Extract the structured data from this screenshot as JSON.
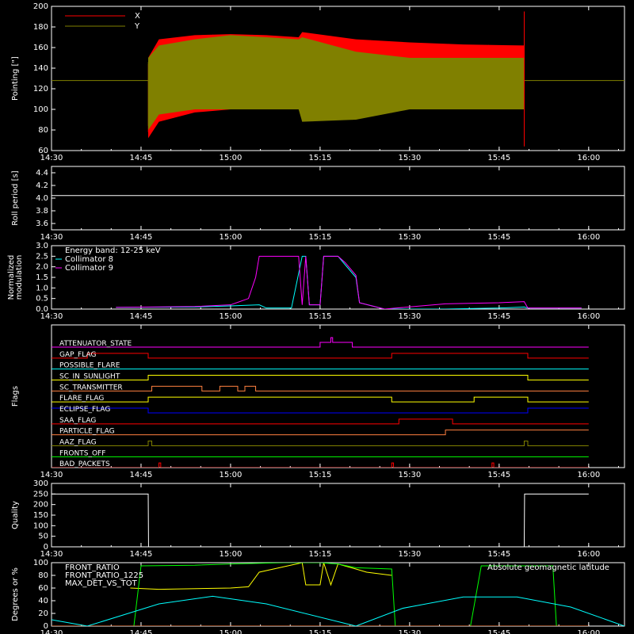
{
  "chart_data": [
    {
      "type": "line",
      "ylabel": "Pointing [\"]",
      "ylim": [
        60,
        200
      ],
      "yticks": [
        60,
        80,
        100,
        120,
        140,
        160,
        180,
        200
      ],
      "xticks": [
        "14:30",
        "14:45",
        "15:00",
        "15:15",
        "15:30",
        "15:45",
        "16:00"
      ],
      "series": [
        {
          "name": "X",
          "color": "#ff0000",
          "t": [
            14.77,
            14.8,
            14.9,
            15.0,
            15.1,
            15.19,
            15.2,
            15.35,
            15.5,
            15.65,
            15.82
          ],
          "upper": [
            150,
            168,
            172,
            173,
            172,
            170,
            175,
            168,
            165,
            163,
            162
          ],
          "lower": [
            72,
            88,
            97,
            100,
            103,
            102,
            100,
            107,
            104,
            108,
            110
          ]
        },
        {
          "name": "Y",
          "color": "#808000",
          "t": [
            14.77,
            14.8,
            14.9,
            15.0,
            15.1,
            15.19,
            15.2,
            15.35,
            15.5,
            15.65,
            15.82
          ],
          "upper": [
            150,
            162,
            168,
            172,
            170,
            168,
            170,
            156,
            150,
            150,
            150
          ],
          "lower": [
            80,
            95,
            100,
            100,
            100,
            100,
            88,
            90,
            100,
            100,
            100
          ]
        }
      ],
      "baseline": 128
    },
    {
      "type": "line",
      "ylabel": "Roll period [s]",
      "ylim": [
        3.5,
        4.5
      ],
      "yticks": [
        3.6,
        3.8,
        4.0,
        4.2,
        4.4
      ],
      "xticks": [
        "14:30",
        "14:45",
        "15:00",
        "15:15",
        "15:30",
        "15:45",
        "16:00"
      ],
      "series": [
        {
          "name": "roll",
          "color": "#ffffff",
          "value": 4.04
        }
      ]
    },
    {
      "type": "line",
      "ylabel": "Normalized modulation",
      "ylim": [
        0,
        3.0
      ],
      "yticks": [
        0.0,
        0.5,
        1.0,
        1.5,
        2.0,
        2.5,
        3.0
      ],
      "xticks": [
        "14:30",
        "14:45",
        "15:00",
        "15:15",
        "15:30",
        "15:45",
        "16:00"
      ],
      "legend": [
        "Energy band: 12-25 keV",
        "Collimator 8",
        "Collimator 9"
      ],
      "series": [
        {
          "name": "Collimator 8",
          "color": "#00ffff",
          "t": [
            14.68,
            14.9,
            15.0,
            15.08,
            15.1,
            15.17,
            15.2,
            15.21,
            15.22,
            15.25,
            15.26,
            15.3,
            15.32,
            15.35,
            15.36,
            15.43,
            15.6,
            15.75,
            15.82,
            15.83,
            15.98
          ],
          "v": [
            0.08,
            0.1,
            0.15,
            0.2,
            0.05,
            0.05,
            2.5,
            2.5,
            0.2,
            0.2,
            2.5,
            2.5,
            2.1,
            1.5,
            0.3,
            0.0,
            0.0,
            0.05,
            0.1,
            0.05,
            0.05
          ]
        },
        {
          "name": "Collimator 9",
          "color": "#ff00ff",
          "t": [
            14.68,
            14.9,
            15.0,
            15.05,
            15.07,
            15.08,
            15.1,
            15.19,
            15.2,
            15.21,
            15.22,
            15.25,
            15.26,
            15.3,
            15.32,
            15.35,
            15.36,
            15.43,
            15.6,
            15.75,
            15.82,
            15.83,
            15.98
          ],
          "v": [
            0.08,
            0.12,
            0.2,
            0.5,
            1.5,
            2.5,
            2.5,
            2.5,
            0.2,
            2.5,
            0.2,
            0.2,
            2.5,
            2.5,
            2.2,
            1.6,
            0.3,
            0.0,
            0.25,
            0.3,
            0.35,
            0.05,
            0.05
          ]
        }
      ]
    },
    {
      "type": "table",
      "ylabel": "Flags",
      "xticks": [
        "14:30",
        "14:45",
        "15:00",
        "15:15",
        "15:30",
        "15:45",
        "16:00"
      ],
      "flags": [
        {
          "name": "ATTENUATOR_STATE",
          "color": "#ff00ff",
          "segments": [
            [
              14.5,
              0
            ],
            [
              15.25,
              1
            ],
            [
              15.28,
              2
            ],
            [
              15.285,
              1
            ],
            [
              15.34,
              0
            ],
            [
              16.0,
              0
            ]
          ]
        },
        {
          "name": "GAP_FLAG",
          "color": "#ff0000",
          "segments": [
            [
              14.5,
              0
            ],
            [
              14.6,
              1
            ],
            [
              14.77,
              0
            ],
            [
              15.45,
              1
            ],
            [
              15.83,
              0
            ],
            [
              16.0,
              0
            ]
          ]
        },
        {
          "name": "POSSIBLE_FLARE",
          "color": "#00ffff",
          "segments": [
            [
              14.5,
              0
            ],
            [
              16.0,
              0
            ]
          ]
        },
        {
          "name": "SC_IN_SUNLIGHT",
          "color": "#ffff00",
          "segments": [
            [
              14.5,
              0
            ],
            [
              14.77,
              1
            ],
            [
              15.83,
              0
            ],
            [
              16.0,
              0
            ]
          ]
        },
        {
          "name": "SC_TRANSMITTER",
          "color": "#ff8040",
          "segments": [
            [
              14.5,
              0
            ],
            [
              14.78,
              1
            ],
            [
              14.92,
              0
            ],
            [
              14.97,
              1
            ],
            [
              15.02,
              0
            ],
            [
              15.04,
              1
            ],
            [
              15.07,
              0
            ],
            [
              15.2,
              0
            ],
            [
              16.0,
              0
            ]
          ]
        },
        {
          "name": "FLARE_FLAG",
          "color": "#ffff00",
          "segments": [
            [
              14.5,
              0
            ],
            [
              14.77,
              1
            ],
            [
              15.45,
              0
            ],
            [
              15.68,
              1
            ],
            [
              15.83,
              0
            ],
            [
              16.0,
              0
            ]
          ]
        },
        {
          "name": "ECLIPSE_FLAG",
          "color": "#0000ff",
          "segments": [
            [
              14.5,
              1
            ],
            [
              14.77,
              0
            ],
            [
              15.83,
              1
            ],
            [
              16.0,
              1
            ]
          ]
        },
        {
          "name": "SAA_FLAG",
          "color": "#ff0000",
          "segments": [
            [
              14.5,
              0
            ],
            [
              15.47,
              1
            ],
            [
              15.62,
              0
            ],
            [
              16.0,
              0
            ]
          ]
        },
        {
          "name": "PARTICLE_FLAG",
          "color": "#ff8040",
          "segments": [
            [
              14.5,
              0
            ],
            [
              15.6,
              1
            ],
            [
              16.0,
              1
            ]
          ]
        },
        {
          "name": "AAZ_FLAG",
          "color": "#808000",
          "segments": [
            [
              14.5,
              0
            ],
            [
              14.77,
              1
            ],
            [
              14.78,
              0
            ],
            [
              15.82,
              1
            ],
            [
              15.83,
              0
            ],
            [
              16.0,
              0
            ]
          ]
        },
        {
          "name": "FRONTS_OFF",
          "color": "#00ff00",
          "segments": [
            [
              14.5,
              0
            ],
            [
              16.0,
              0
            ]
          ]
        },
        {
          "name": "BAD_PACKETS",
          "color": "#ff0000",
          "segments": [
            [
              14.5,
              0
            ],
            [
              14.8,
              1
            ],
            [
              14.805,
              0
            ],
            [
              15.45,
              1
            ],
            [
              15.455,
              0
            ],
            [
              15.73,
              1
            ],
            [
              15.735,
              0
            ],
            [
              16.0,
              0
            ]
          ]
        }
      ]
    },
    {
      "type": "line",
      "ylabel": "Quality",
      "ylim": [
        0,
        300
      ],
      "yticks": [
        0,
        50,
        100,
        150,
        200,
        250,
        300
      ],
      "xticks": [
        "14:30",
        "14:45",
        "15:00",
        "15:15",
        "15:30",
        "15:45",
        "16:00"
      ],
      "series": [
        {
          "name": "quality",
          "color": "#ffffff",
          "t": [
            14.5,
            14.77,
            14.771,
            15.82,
            15.821,
            16.0
          ],
          "v": [
            250,
            250,
            0,
            0,
            250,
            250
          ]
        }
      ]
    },
    {
      "type": "line",
      "ylabel": "Degrees or %",
      "ylim": [
        0,
        100
      ],
      "yticks": [
        0,
        20,
        40,
        60,
        80,
        100
      ],
      "xticks": [
        "14:30",
        "14:45",
        "15:00",
        "15:15",
        "15:30",
        "15:45",
        "16:00"
      ],
      "legend": [
        "FRONT_RATIO",
        "FRONT_RATIO_1225",
        "MAX_DET_VS_TOT"
      ],
      "annotation": "Absolute geomagnetic latitude",
      "series": [
        {
          "name": "FRONT_RATIO",
          "color": "#ffff00",
          "t": [
            14.72,
            14.8,
            15.0,
            15.05,
            15.08,
            15.2,
            15.21,
            15.25,
            15.26,
            15.28,
            15.3,
            15.35,
            15.38,
            15.45
          ],
          "v": [
            60,
            58,
            60,
            62,
            85,
            100,
            65,
            65,
            100,
            65,
            98,
            90,
            85,
            80
          ]
        },
        {
          "name": "FRONT_RATIO_1225",
          "color": "#00ff00",
          "t": [
            14.73,
            14.75,
            14.9,
            15.0,
            15.15,
            15.25,
            15.3,
            15.35,
            15.45,
            15.46,
            15.67,
            15.7,
            15.8,
            15.9,
            15.91
          ],
          "v": [
            0,
            95,
            96,
            98,
            100,
            100,
            98,
            92,
            90,
            0,
            0,
            95,
            95,
            95,
            0
          ]
        },
        {
          "name": "MAX_DET_VS_TOT",
          "color": "#ff8040",
          "t": [
            14.5,
            16.0
          ],
          "v": [
            0,
            0
          ]
        },
        {
          "name": "latitude",
          "color": "#00ffff",
          "t": [
            14.5,
            14.6,
            14.8,
            14.95,
            15.1,
            15.35,
            15.48,
            15.65,
            15.8,
            15.95,
            16.1
          ],
          "v": [
            10,
            0,
            35,
            47,
            35,
            0,
            28,
            46,
            46,
            30,
            0
          ]
        }
      ]
    }
  ]
}
